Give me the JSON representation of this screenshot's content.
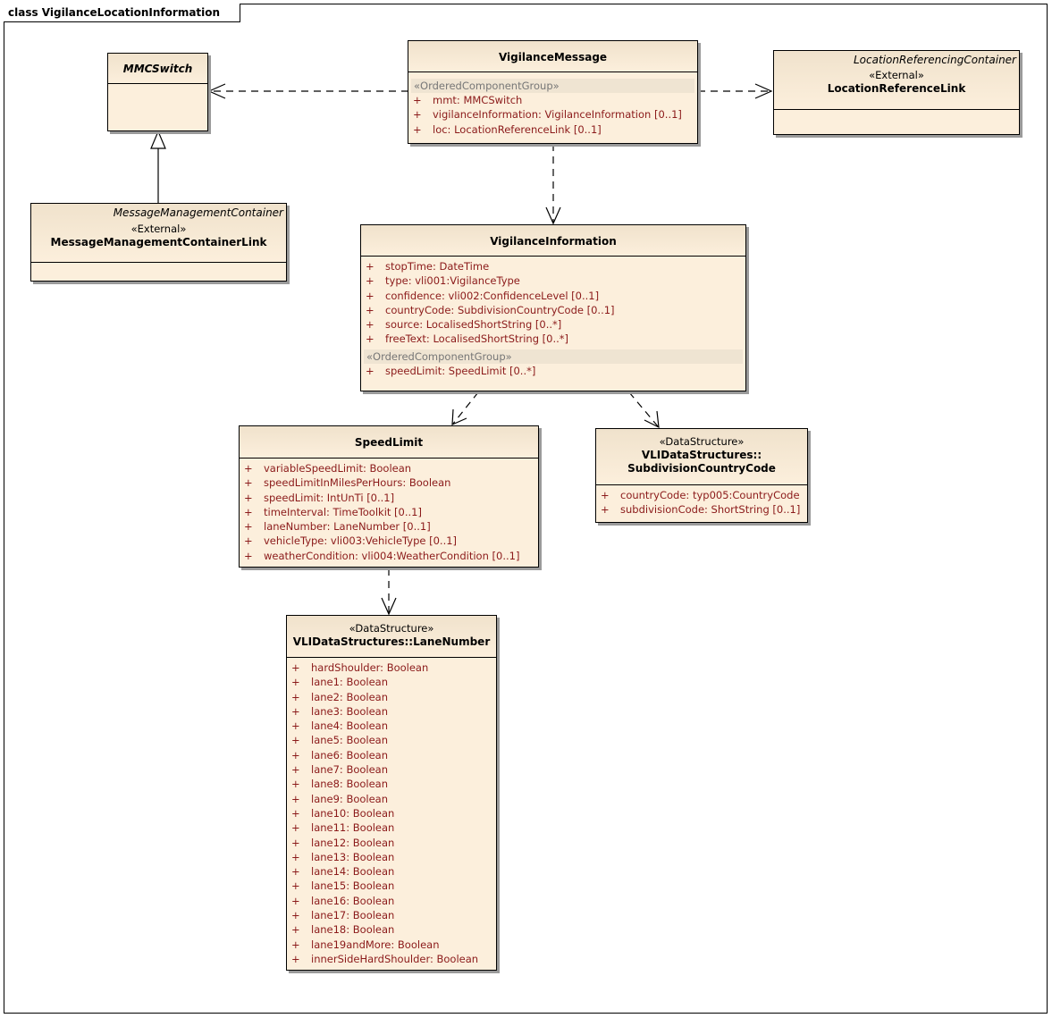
{
  "frame": {
    "title": "class VigilanceLocationInformation"
  },
  "classes": {
    "mmc_switch": {
      "name": "MMCSwitch"
    },
    "vigilance_message": {
      "name": "VigilanceMessage",
      "group": "«OrderedComponentGroup»",
      "attributes": [
        {
          "vis": "+",
          "text": "mmt:  MMCSwitch"
        },
        {
          "vis": "+",
          "text": "vigilanceInformation:  VigilanceInformation [0..1]"
        },
        {
          "vis": "+",
          "text": "loc:  LocationReferenceLink [0..1]"
        }
      ]
    },
    "location_reference_link": {
      "package": "LocationReferencingContainer",
      "stereotype": "«External»",
      "name": "LocationReferenceLink"
    },
    "message_management_link": {
      "package": "MessageManagementContainer",
      "stereotype": "«External»",
      "name": "MessageManagementContainerLink"
    },
    "vigilance_information": {
      "name": "VigilanceInformation",
      "attributes": [
        {
          "vis": "+",
          "text": "stopTime:  DateTime"
        },
        {
          "vis": "+",
          "text": "type:  vli001:VigilanceType"
        },
        {
          "vis": "+",
          "text": "confidence:  vli002:ConfidenceLevel [0..1]"
        },
        {
          "vis": "+",
          "text": "countryCode:  SubdivisionCountryCode [0..1]"
        },
        {
          "vis": "+",
          "text": "source:  LocalisedShortString [0..*]"
        },
        {
          "vis": "+",
          "text": "freeText:  LocalisedShortString [0..*]"
        }
      ],
      "group": "«OrderedComponentGroup»",
      "group_attributes": [
        {
          "vis": "+",
          "text": "speedLimit:  SpeedLimit [0..*]"
        }
      ]
    },
    "speed_limit": {
      "name": "SpeedLimit",
      "attributes": [
        {
          "vis": "+",
          "text": "variableSpeedLimit:  Boolean"
        },
        {
          "vis": "+",
          "text": "speedLimitInMilesPerHours:  Boolean"
        },
        {
          "vis": "+",
          "text": "speedLimit:  IntUnTi [0..1]"
        },
        {
          "vis": "+",
          "text": "timeInterval:  TimeToolkit [0..1]"
        },
        {
          "vis": "+",
          "text": "laneNumber:  LaneNumber [0..1]"
        },
        {
          "vis": "+",
          "text": "vehicleType:  vli003:VehicleType [0..1]"
        },
        {
          "vis": "+",
          "text": "weatherCondition:  vli004:WeatherCondition [0..1]"
        }
      ]
    },
    "subdivision_country_code": {
      "stereotype": "«DataStructure»",
      "name_line1": "VLIDataStructures::",
      "name_line2": "SubdivisionCountryCode",
      "attributes": [
        {
          "vis": "+",
          "text": "countryCode:  typ005:CountryCode"
        },
        {
          "vis": "+",
          "text": "subdivisionCode:  ShortString [0..1]"
        }
      ]
    },
    "lane_number": {
      "stereotype": "«DataStructure»",
      "name": "VLIDataStructures::LaneNumber",
      "attributes": [
        {
          "vis": "+",
          "text": "hardShoulder:  Boolean"
        },
        {
          "vis": "+",
          "text": "lane1:  Boolean"
        },
        {
          "vis": "+",
          "text": "lane2:  Boolean"
        },
        {
          "vis": "+",
          "text": "lane3:  Boolean"
        },
        {
          "vis": "+",
          "text": "lane4:  Boolean"
        },
        {
          "vis": "+",
          "text": "lane5:  Boolean"
        },
        {
          "vis": "+",
          "text": "lane6:  Boolean"
        },
        {
          "vis": "+",
          "text": "lane7:  Boolean"
        },
        {
          "vis": "+",
          "text": "lane8:  Boolean"
        },
        {
          "vis": "+",
          "text": "lane9:  Boolean"
        },
        {
          "vis": "+",
          "text": "lane10:  Boolean"
        },
        {
          "vis": "+",
          "text": "lane11:  Boolean"
        },
        {
          "vis": "+",
          "text": "lane12:  Boolean"
        },
        {
          "vis": "+",
          "text": "lane13:  Boolean"
        },
        {
          "vis": "+",
          "text": "lane14:  Boolean"
        },
        {
          "vis": "+",
          "text": "lane15:  Boolean"
        },
        {
          "vis": "+",
          "text": "lane16:  Boolean"
        },
        {
          "vis": "+",
          "text": "lane17:  Boolean"
        },
        {
          "vis": "+",
          "text": "lane18:  Boolean"
        },
        {
          "vis": "+",
          "text": "lane19andMore:  Boolean"
        },
        {
          "vis": "+",
          "text": "innerSideHardShoulder:  Boolean"
        }
      ]
    }
  },
  "colors": {
    "box_fill": "#fcefdc",
    "attribute_text": "#8b1a1a",
    "group_text": "#777777",
    "line": "#000000"
  }
}
